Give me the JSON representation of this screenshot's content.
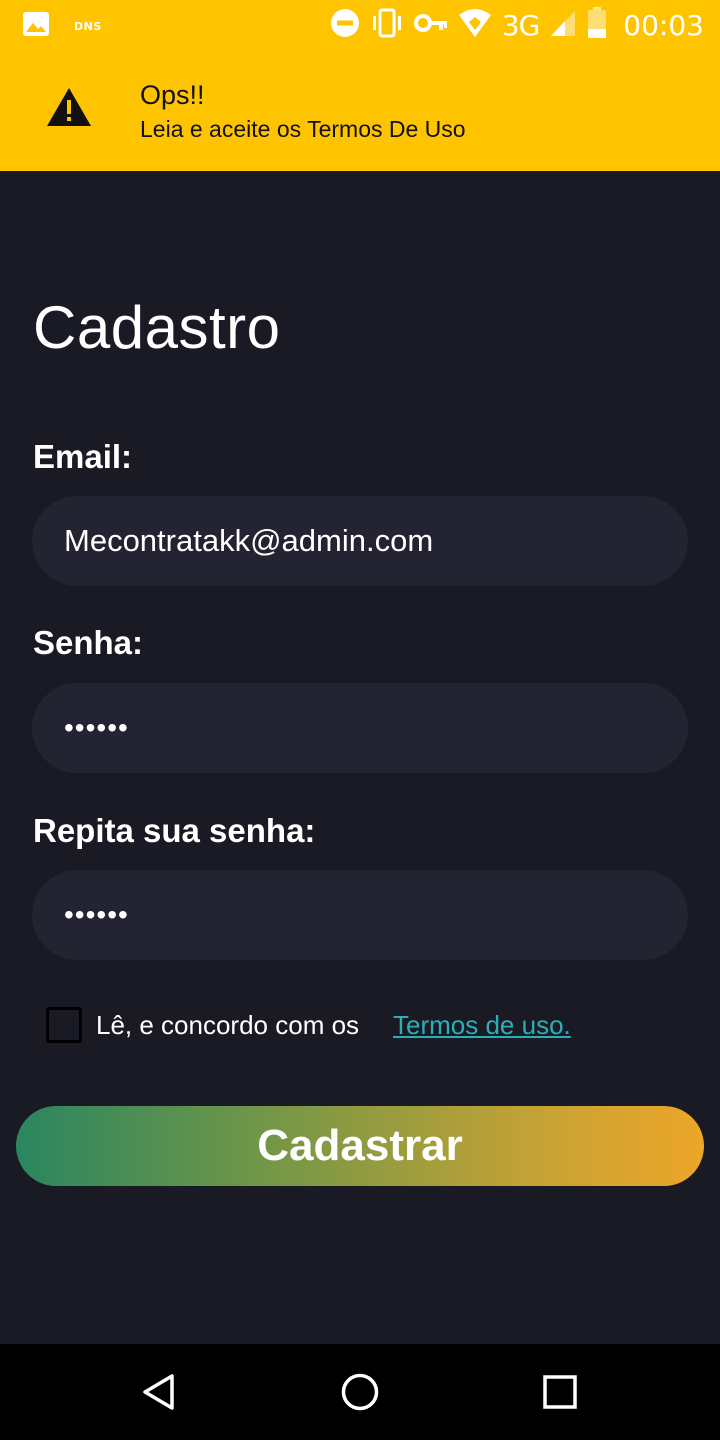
{
  "status_bar": {
    "left_icons": [
      "image-icon"
    ],
    "dns_label": "DNS",
    "right_icons": [
      "do-not-disturb-icon",
      "vibrate-icon",
      "vpn-key-icon",
      "wifi-icon",
      "signal-icon",
      "battery-icon"
    ],
    "network": "3G",
    "time": "00:03"
  },
  "toast": {
    "icon": "warning-icon",
    "title": "Ops!!",
    "message": "Leia e aceite os Termos De Uso",
    "color": "#fec400"
  },
  "form": {
    "title": "Cadastro",
    "email": {
      "label": "Email:",
      "value": "Mecontratakk@admin.com"
    },
    "password": {
      "label": "Senha:",
      "value": "••••••"
    },
    "repeat_password": {
      "label": "Repita sua senha:",
      "value": "••••••"
    },
    "terms": {
      "checked": false,
      "text": "Lê, e concordo com os",
      "link": "Termos de uso.",
      "link_color": "#2bafb7"
    },
    "submit_label": "Cadastrar"
  },
  "nav_bar": {
    "buttons": [
      "back-icon",
      "home-icon",
      "recents-icon"
    ]
  },
  "colors": {
    "background": "#191a23",
    "input_background": "#232332",
    "gradient_start": "#2a8660",
    "gradient_end": "#eda628"
  }
}
